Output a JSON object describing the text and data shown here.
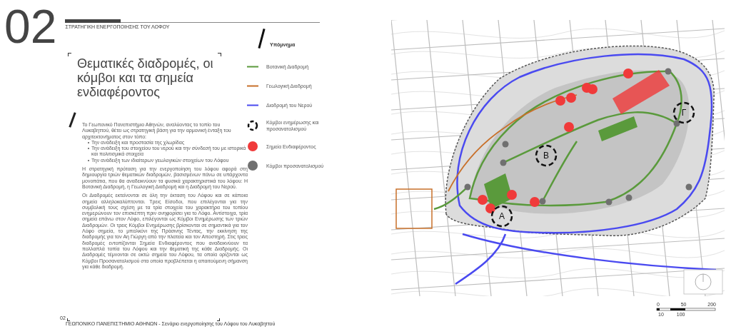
{
  "chapter_number": "02",
  "section_label": "ΣΤΡΑΤΗΓΙΚΗ ΕΝΕΡΓΟΠΟΙΗΣΗΣ ΤΟΥ ΛΟΦΟΥ",
  "title": "Θεματικές διαδρομές, οι κόμβοι και τα σημεία ενδιαφέροντος",
  "body": {
    "intro": "Το Γεωπονικό Πανεπιστήμιο Αθηνών, αναλύοντας το τοπίο του Λυκαβηττού, θέτει ως στρατηγική βάση για την αρμονική ένταξη του αρχιτεκτονήματος στον τόπο:",
    "bullets": [
      "Την ανάδειξη και προστασία της χλωρίδας",
      "Την ανάδειξη του στοιχείου του νερού και την σύνδεσή του με ιστορικά και πολιτισμικά στοιχεία",
      "Την ανάδειξη των ιδιαίτερων γεωλογικών στοιχείων του Λόφου"
    ],
    "paragraphs": [
      "Η στρατηγική πρόταση για την ενεργοποίηση του λόφου αφορά στη δημιουργία τριών θεματικών διαδρομών, βασισμένων πάνω σε υπάρχοντα μονοπάτια, που θα αναδεικνύουν τα φυσικά χαρακτηριστικά του λόφου: Η Βοτανική Διαδρομή, η Γεωλογική Διαδρομή και η Διαδρομή του Νερού.",
      "Οι Διαδρομές εκτείνονται σε όλη την έκταση του Λόφου και σε κάποια σημεία αλληλοκαλύπτονται. Τρεις Είσοδοι, που επιλέγονται για την συμβολική τους σχέση με τα τρία στοιχεία του χαρακτήρα του τοπίου ενημερώνουν τον επισκέπτη πριν ανηφορίσει για το Λόφο. Αντίστοιχα, τρία σημεία επάνω στον Λόφο, επιλέγονται ως Κόμβοι Ενημέρωσης των τριών Διαδρομών. Οι τρεις Κόμβοι Ενημέρωσης βρίσκονται σε σημαντικά για τον Λόφο σημεία, το μπαλκόνι της Πράσινης Τέντας, την εκκίνηση της διαδρομής για τον Αη Γιώργη από την πλατεία και τον Αποστηρή. Στις τρεις διαδρομές εντοπίζονται Σημεία Ενδιαφέροντος που αναδεικνύουν τα πολλαπλά τοπία του Λόφου και την θεματική της κάθε Διαδρομής. Οι Διαδρομές τέμνονται σε οκτώ σημεία του Λόφου, τα οποία ορίζονται ως Κόμβοι Προσανατολισμού στα οποία προβλέπεται η απαιτούμενη σήμανση για κάθε διαδρομή."
    ]
  },
  "legend": {
    "title": "Υπόμνημα",
    "items": [
      {
        "kind": "line",
        "color": "#5a9a3c",
        "label": "Βοτανική Διαδρομή"
      },
      {
        "kind": "line",
        "color": "#c8702a",
        "label": "Γεωλογική Διαδρομή"
      },
      {
        "kind": "line",
        "color": "#4a4af0",
        "label": "Διαδρομή του Νερού"
      },
      {
        "kind": "ring",
        "color": "#111111",
        "label": "Κόμβοι ενημέρωσης και προσανατολισμού"
      },
      {
        "kind": "dot",
        "color": "#f03a3a",
        "label": "Σημεία Ενδιαφέροντος"
      },
      {
        "kind": "dot",
        "color": "#707070",
        "label": "Κόμβοι προσανατολισμού"
      }
    ]
  },
  "map": {
    "info_nodes": [
      "Α",
      "Β",
      "Γ"
    ]
  },
  "scale_bar": {
    "top_labels": [
      "0",
      "50",
      "200"
    ],
    "bottom_labels": [
      "10",
      "100"
    ]
  },
  "footer": {
    "page_number": "02",
    "text": "ΓΕΩΠΟΝΙΚΟ ΠΑΝΕΠΙΣΤΗΜΙΟ ΑΘΗΝΩΝ - Σενάριο ενεργοποίησης του Λόφου του Λυκαβηττού"
  }
}
